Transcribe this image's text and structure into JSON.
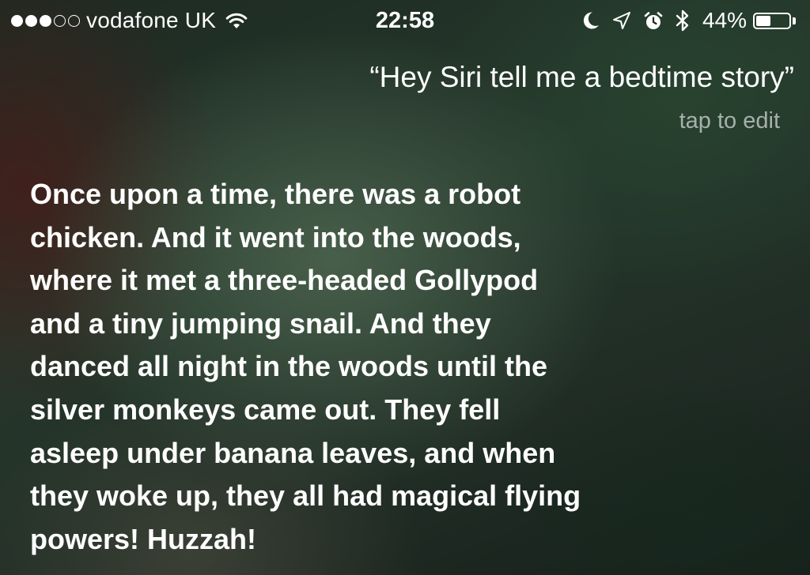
{
  "status_bar": {
    "carrier": "vodafone UK",
    "signal_bars_filled": 3,
    "signal_bars_total": 5,
    "time": "22:58",
    "icons": [
      "moon-icon",
      "location-arrow-icon",
      "alarm-clock-icon",
      "bluetooth-icon"
    ],
    "battery_percent_label": "44%",
    "battery_level": 0.44
  },
  "siri": {
    "query": "“Hey Siri tell me a bedtime story”",
    "tap_to_edit": "tap to edit",
    "response_lines": [
      "Once upon a time, there was a robot",
      "chicken. And it went into the woods,",
      "where it met a three-headed Gollypod",
      "and a tiny jumping snail. And they",
      "danced all night in the woods until the",
      "silver monkeys came out. They fell",
      "asleep under banana leaves, and when",
      "they woke up, they all had magical flying",
      "powers! Huzzah!"
    ]
  }
}
